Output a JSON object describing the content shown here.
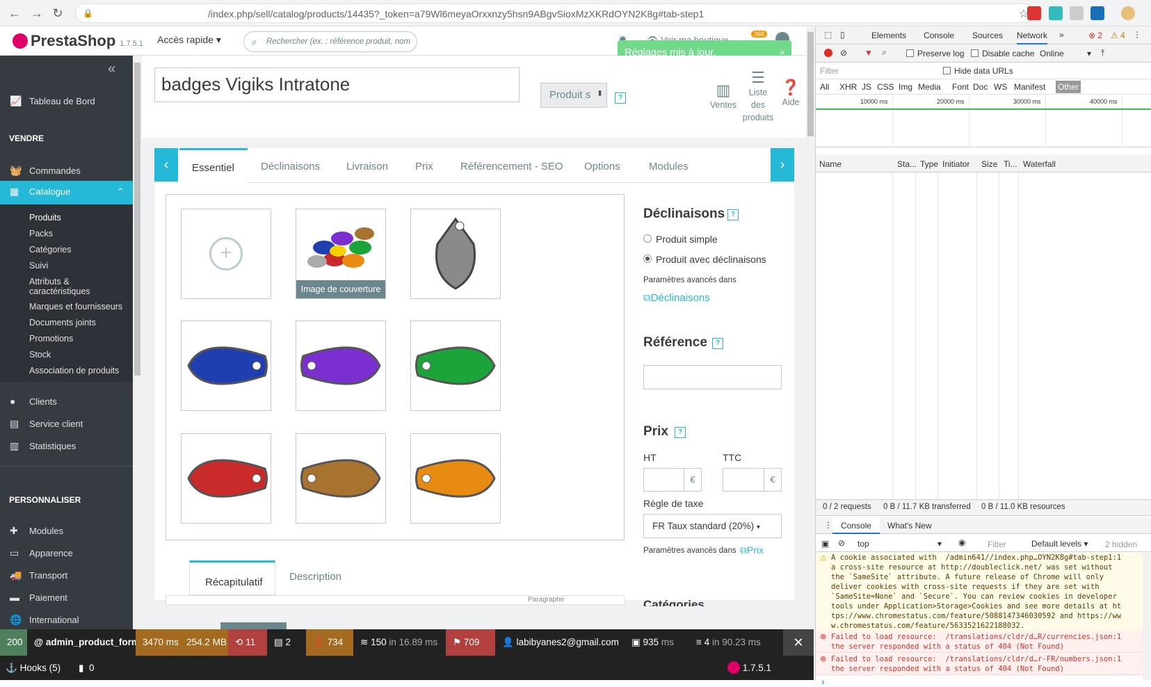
{
  "browser": {
    "url_prefix": "",
    "url": "/index.php/sell/catalog/products/14435?_token=a79Wl6meyaOrxxnzy5hsn9ABgvSioxMzXKRdOYN2K8g#tab-step1"
  },
  "header": {
    "logo": "PrestaShop",
    "version": "1.7.5.1",
    "quick_access": "Accès rapide",
    "search_placeholder": "Rechercher (ex. : référence produit, nom",
    "view_shop": "Voir ma boutique",
    "notif_count": "268"
  },
  "notification": {
    "text": "Réglages mis à jour.",
    "close": "×"
  },
  "sidebar": {
    "dashboard": "Tableau de Bord",
    "sell_heading": "VENDRE",
    "orders": "Commandes",
    "catalog": "Catalogue",
    "catalog_items": [
      "Produits",
      "Packs",
      "Catégories",
      "Suivi",
      "Attributs &\ncaractéristiques",
      "Marques et fournisseurs",
      "Documents joints",
      "Promotions",
      "Stock",
      "Association de produits"
    ],
    "customers": "Clients",
    "service": "Service client",
    "stats": "Statistiques",
    "customize_heading": "PERSONNALISER",
    "modules": "Modules",
    "appearance": "Apparence",
    "transport": "Transport",
    "payment": "Paiement",
    "international": "International"
  },
  "product": {
    "name": "badges Vigiks Intratone",
    "type": "Produit s"
  },
  "toolbar": {
    "sales": "Ventes",
    "list": "Liste\ndes\nproduits",
    "help": "Aide"
  },
  "tabs": [
    "Essentiel",
    "Déclinaisons",
    "Livraison",
    "Prix",
    "Référencement - SEO",
    "Options",
    "Modules"
  ],
  "images": {
    "cover_label": "Image de couverture",
    "colors": [
      "#c9a85f",
      "#8a8a8a",
      "#1f3fb0",
      "#7b2fd0",
      "#1aa43a",
      "#c92a2a",
      "#a8722f",
      "#e88b12"
    ]
  },
  "side": {
    "combinations_title": "Déclinaisons",
    "simple": "Produit simple",
    "with_comb": "Produit avec déclinaisons",
    "advanced": "Paramètres avancés dans",
    "comb_link": "Déclinaisons",
    "reference_title": "Référence",
    "price_title": "Prix",
    "ht": "HT",
    "ttc": "TTC",
    "currency": "€",
    "tax_rule_label": "Règle de taxe",
    "tax_rule": "FR Taux standard (20%)",
    "price_link": "Prix",
    "categories_title": "Catégories"
  },
  "bottom_tabs": [
    "Récapitulatif",
    "Description"
  ],
  "editor_paragraph": "Paragraphe",
  "debug": {
    "status": "200",
    "route": "@ admin_product_form",
    "time": "3470 ms",
    "memory": "254.2 MB",
    "symfony": "11",
    "forms": "2",
    "warnings": "734",
    "doctrine": "150",
    "doctrine_time": "in 16.89 ms",
    "exceptions": "709",
    "user": "labibyanes2@gmail.com",
    "twig": "935",
    "twig_unit": "ms",
    "cache": "4",
    "cache_time": "in 90.23 ms",
    "hooks": "Hooks (5)",
    "legacy": "0",
    "ps_version": "1.7.5.1"
  },
  "devtools": {
    "tabs": [
      "Elements",
      "Console",
      "Sources",
      "Network"
    ],
    "errors": "2",
    "warnings": "4",
    "preserve_log": "Preserve log",
    "disable_cache": "Disable cache",
    "throttle": "Online",
    "filter": "Filter",
    "hide_data_urls": "Hide data URLs",
    "types": [
      "All",
      "XHR",
      "JS",
      "CSS",
      "Img",
      "Media",
      "Font",
      "Doc",
      "WS",
      "Manifest",
      "Other"
    ],
    "timeline": [
      "10000 ms",
      "20000 ms",
      "30000 ms",
      "40000 ms"
    ],
    "columns": [
      "Name",
      "Sta...",
      "Type",
      "Initiator",
      "Size",
      "Ti...",
      "Waterfall"
    ],
    "summary": [
      "0 / 2 requests",
      "0 B / 11.7 KB transferred",
      "0 B / 11.0 KB resources"
    ],
    "drawer_tabs": [
      "Console",
      "What's New"
    ],
    "context": "top",
    "levels": "Default levels",
    "hidden": "2 hidden",
    "console": [
      "A cookie associated with  /admin641//index.php…OYN2K8g#tab-step1:1",
      "a cross-site resource at http://doubleclick.net/ was set without",
      "the `SameSite` attribute. A future release of Chrome will only",
      "deliver cookies with cross-site requests if they are set with",
      "`SameSite=None` and `Secure`. You can review cookies in developer",
      "tools under Application>Storage>Cookies and see more details at ht",
      "tps://www.chromestatus.com/feature/5088147346030592 and https://ww",
      "w.chromestatus.com/feature/5633521622188032."
    ],
    "errors_list": [
      [
        "Failed to load resource:  /translations/cldr/d…R/currencies.json:1",
        "the server responded with a status of 404 (Not Found)"
      ],
      [
        "Failed to load resource:  /translations/cldr/d…r-FR/numbers.json:1",
        "the server responded with a status of 404 (Not Found)"
      ]
    ],
    "prompt": "›"
  }
}
